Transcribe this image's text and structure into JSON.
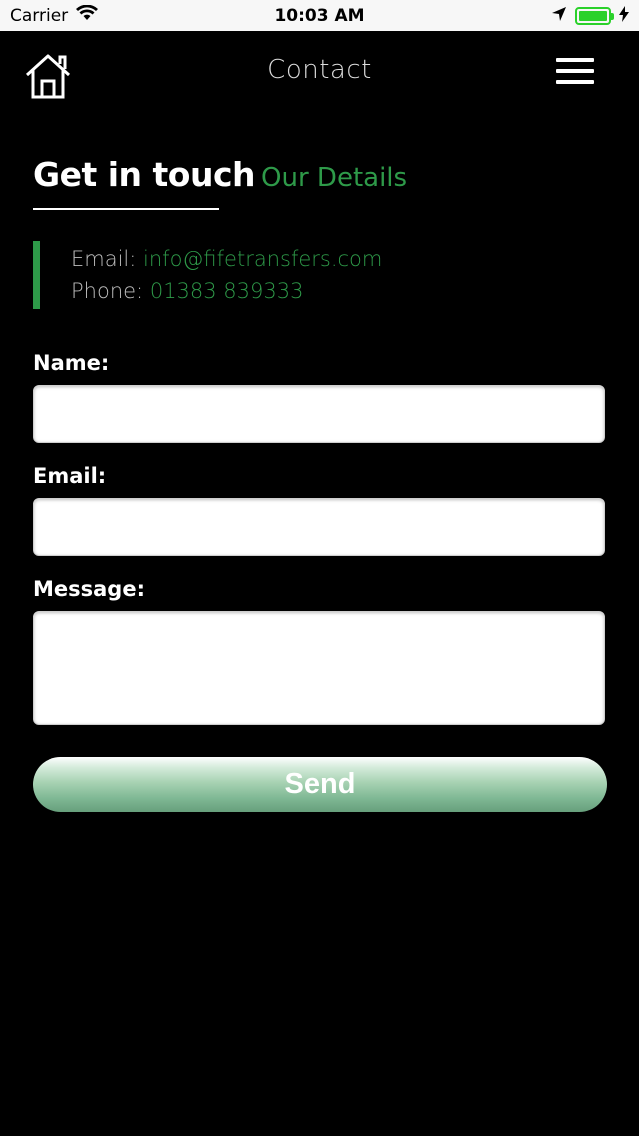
{
  "status_bar": {
    "carrier": "Carrier",
    "time": "10:03 AM",
    "wifi_icon": "wifi-icon",
    "location_icon": "location-arrow-icon",
    "battery_icon": "battery-icon",
    "charging_icon": "bolt-icon",
    "battery_level": 1.0,
    "battery_color": "#2ad12a"
  },
  "nav": {
    "title": "Contact",
    "home_icon": "home-icon",
    "menu_icon": "hamburger-menu-icon"
  },
  "contact": {
    "heading": "Get in touch",
    "subheading": "Our Details",
    "email_label": "Email:",
    "email_value": "info@fifetransfers.com",
    "phone_label": "Phone:",
    "phone_value": "01383 839333"
  },
  "form": {
    "name_label": "Name:",
    "name_value": "",
    "email_label": "Email:",
    "email_value": "",
    "message_label": "Message:",
    "message_value": "",
    "send_label": "Send"
  },
  "colors": {
    "background": "#000000",
    "accent_green": "#2e9a49",
    "text_light": "#bdbdbd"
  }
}
